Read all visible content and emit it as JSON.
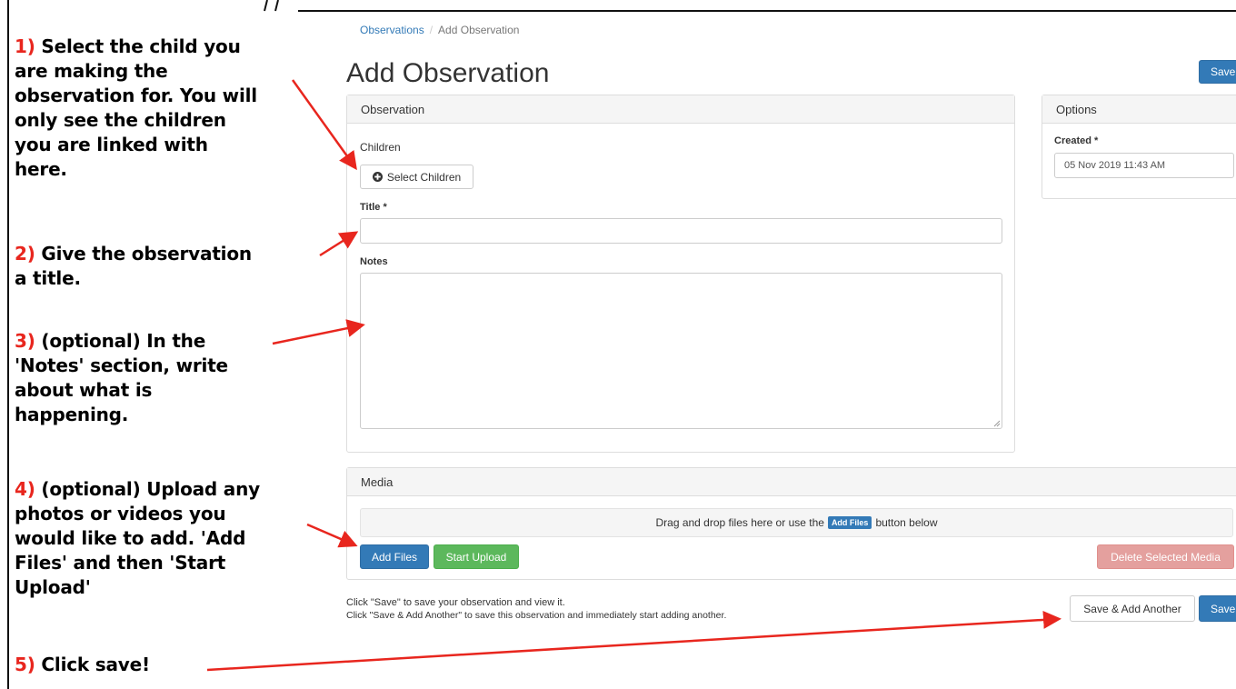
{
  "instructions": [
    {
      "num": "1)",
      "lines": [
        "Select the child you",
        "are making the",
        "observation for. You will",
        "only see the children",
        "you are linked with",
        "here."
      ]
    },
    {
      "num": "2)",
      "lines": [
        "Give the observation",
        "a title."
      ]
    },
    {
      "num": "3)",
      "lines": [
        "(optional) In the",
        "'Notes' section, write",
        "about what is",
        "happening."
      ]
    },
    {
      "num": "4)",
      "lines": [
        "(optional) Upload any",
        "photos or videos you",
        "would like to add. 'Add",
        "Files' and then 'Start",
        "Upload'"
      ]
    },
    {
      "num": "5)",
      "lines": [
        "Click save!"
      ]
    }
  ],
  "breadcrumb": {
    "root": "Observations",
    "sep": "/",
    "current": "Add Observation"
  },
  "page_title": "Add Observation",
  "header_save": "Save",
  "observation_panel": {
    "heading": "Observation",
    "children_label": "Children",
    "select_children": "Select Children",
    "title_label": "Title *",
    "title_value": "",
    "notes_label": "Notes",
    "notes_value": ""
  },
  "options_panel": {
    "heading": "Options",
    "created_label": "Created *",
    "created_value": "05 Nov 2019 11:43 AM"
  },
  "media_panel": {
    "heading": "Media",
    "drop_text_before": "Drag and drop files here or use the",
    "drop_button": "Add Files",
    "drop_text_after": "button below",
    "add_files": "Add Files",
    "start_upload": "Start Upload",
    "delete_selected": "Delete Selected Media"
  },
  "footer": {
    "help_line1": "Click \"Save\" to save your observation and view it.",
    "help_line2": "Click \"Save & Add Another\" to save this observation and immediately start adding another.",
    "save_add_another": "Save & Add Another",
    "save": "Save"
  },
  "colors": {
    "annotation_red": "#e8261e",
    "primary": "#337ab7",
    "success": "#5cb85c",
    "danger_disabled": "#e4a09e"
  }
}
